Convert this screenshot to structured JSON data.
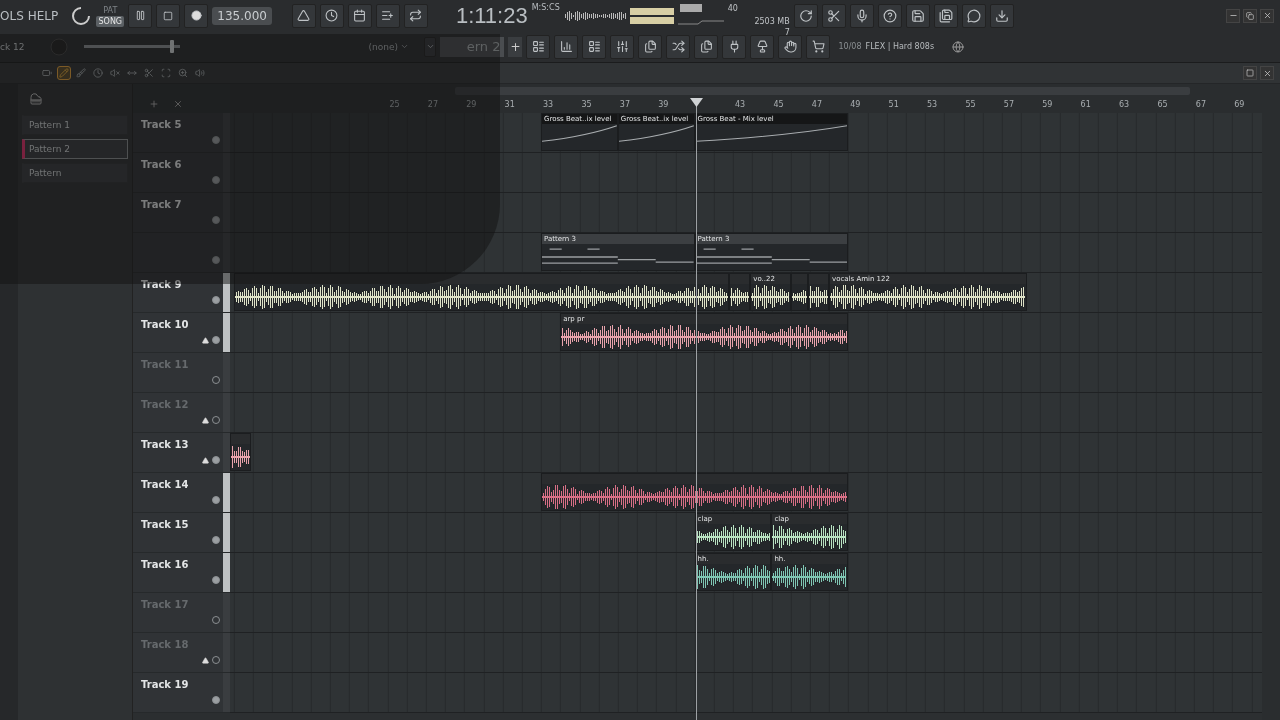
{
  "menu": [
    {
      "label": "OLS"
    },
    {
      "label": "HELP"
    }
  ],
  "mode": [
    {
      "label": "PAT",
      "selected": false
    },
    {
      "label": "SONG",
      "selected": true
    }
  ],
  "tempo": "135.000",
  "time": {
    "value": "1:11:23",
    "unit": "M:S:CS"
  },
  "monitor": {
    "cpu": "40",
    "memory": "2503 MB",
    "voices": "7"
  },
  "row2": {
    "track_name": "ck 12",
    "pitch": {
      "level": 0.93
    },
    "arrangement": "(none)",
    "pattern": "ern 2",
    "add": "+",
    "hint_count": "10/08",
    "hint_text": "FLEX | Hard 808s"
  },
  "playlist": {
    "tools": [
      {
        "selected": false
      },
      {
        "selected": true
      },
      {
        "selected": false
      },
      {
        "selected": false
      },
      {
        "selected": false
      },
      {
        "selected": false
      },
      {
        "selected": false
      },
      {
        "selected": false
      },
      {
        "selected": false
      },
      {
        "selected": false
      }
    ],
    "patterns": [
      {
        "label": "Pattern 1",
        "selected": false
      },
      {
        "label": "Pattern 2",
        "selected": true
      },
      {
        "label": "Pattern",
        "selected": false
      }
    ],
    "ruler": [
      "25",
      "27",
      "29",
      "31",
      "33",
      "35",
      "37",
      "39",
      "43",
      "45",
      "47",
      "49",
      "51",
      "53",
      "55",
      "57",
      "59",
      "61",
      "63",
      "65",
      "67",
      "69"
    ],
    "playhead": {
      "level": 0.452
    },
    "tracks": [
      {
        "label": "Track 5",
        "muted": false,
        "strip": false,
        "arrow": false,
        "clips": [
          {
            "kind": "automation",
            "label": "Gross Beat..ix level"
          },
          {
            "kind": "automation",
            "label": "Gross Beat..ix level"
          },
          {
            "kind": "automation",
            "label": "Gross Beat - Mix level"
          }
        ]
      },
      {
        "label": "Track 6",
        "muted": false,
        "strip": false,
        "arrow": false
      },
      {
        "label": "Track 7",
        "muted": false,
        "strip": false,
        "arrow": false
      },
      {
        "muted": false,
        "strip": false,
        "arrow": false,
        "clips": [
          {
            "kind": "pattern",
            "label": "Pattern 3"
          },
          {
            "kind": "pattern",
            "label": "Pattern 3"
          }
        ]
      },
      {
        "label": "Track 9",
        "muted": false,
        "strip": true,
        "arrow": false,
        "clips": [
          {
            "kind": "audio",
            "color": "#dfe3c8"
          },
          {
            "kind": "audio",
            "color": "#dfe3c8"
          },
          {
            "kind": "audio",
            "color": "#dfe3c8",
            "label": "vo..22"
          },
          {
            "kind": "audio",
            "color": "#dfe3c8"
          },
          {
            "kind": "audio",
            "color": "#dfe3c8"
          },
          {
            "kind": "audio",
            "color": "#dfe3c8",
            "label": "vocals Amin 122"
          }
        ]
      },
      {
        "label": "Track 10",
        "muted": false,
        "strip": true,
        "arrow": true,
        "clips": [
          {
            "kind": "audio",
            "color": "#e8a3ac",
            "label": "arp pr"
          }
        ]
      },
      {
        "label": "Track 11",
        "muted": true,
        "strip": false,
        "arrow": false
      },
      {
        "label": "Track 12",
        "muted": true,
        "strip": false,
        "arrow": true
      },
      {
        "label": "Track 13",
        "muted": false,
        "strip": false,
        "arrow": true,
        "clips": [
          {
            "kind": "audio",
            "color": "#e8a3ac"
          }
        ]
      },
      {
        "label": "Track 14",
        "muted": false,
        "strip": true,
        "arrow": false,
        "clips": [
          {
            "kind": "audio",
            "color": "#d86f86"
          }
        ]
      },
      {
        "label": "Track 15",
        "muted": false,
        "strip": true,
        "arrow": false,
        "clips": [
          {
            "kind": "audio",
            "color": "#b9e3c2",
            "label": "clap"
          },
          {
            "kind": "audio",
            "color": "#b9e3c2",
            "label": "clap"
          }
        ]
      },
      {
        "label": "Track 16",
        "muted": false,
        "strip": true,
        "arrow": false,
        "clips": [
          {
            "kind": "audio",
            "color": "#7fc6b3",
            "label": "hh."
          },
          {
            "kind": "audio",
            "color": "#7fc6b3",
            "label": "hh."
          }
        ]
      },
      {
        "label": "Track 17",
        "muted": true,
        "strip": false,
        "arrow": false
      },
      {
        "label": "Track 18",
        "muted": true,
        "strip": false,
        "arrow": true
      },
      {
        "label": "Track 19",
        "muted": false,
        "strip": false,
        "arrow": false
      }
    ]
  }
}
